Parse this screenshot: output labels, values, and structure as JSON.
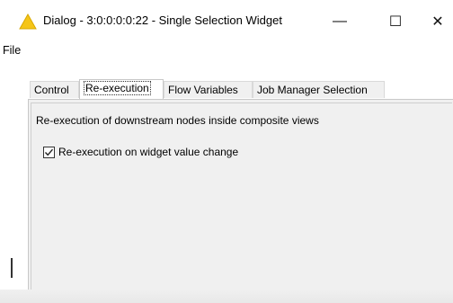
{
  "window": {
    "title": "Dialog - 3:0:0:0:0:22 - Single Selection Widget",
    "app_icon": "warning-triangle-icon",
    "controls": {
      "minimize": "—",
      "maximize": "☐",
      "close": "✕"
    }
  },
  "menubar": {
    "file": "File"
  },
  "tabs": [
    {
      "label": "Control"
    },
    {
      "label": "Re-execution",
      "active": true
    },
    {
      "label": "Flow Variables"
    },
    {
      "label": "Job Manager Selection"
    }
  ],
  "panel": {
    "section_label": "Re-execution of downstream nodes inside composite views",
    "checkbox": {
      "label": "Re-execution on widget value change",
      "checked": true
    }
  },
  "colors": {
    "icon_yellow": "#f5c518",
    "panel_bg": "#f0f0f0"
  }
}
